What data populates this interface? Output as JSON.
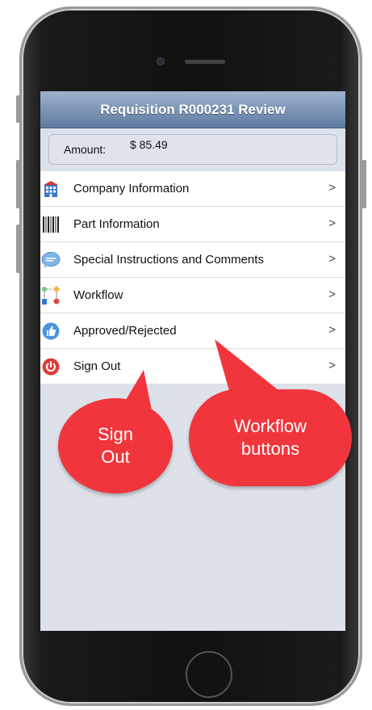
{
  "screen": {
    "title": "Requisition R000231 Review",
    "amount_label": "Amount:",
    "amount_value": "$ 85.49"
  },
  "menu": [
    {
      "label": "Company Information",
      "icon": "building-icon"
    },
    {
      "label": "Part Information",
      "icon": "barcode-icon"
    },
    {
      "label": "Special Instructions and Comments",
      "icon": "speech-bubble-icon"
    },
    {
      "label": "Workflow",
      "icon": "workflow-icon"
    },
    {
      "label": "Approved/Rejected",
      "icon": "thumbs-up-icon"
    },
    {
      "label": "Sign Out",
      "icon": "power-icon"
    }
  ],
  "chevron": ">",
  "callouts": {
    "sign_out_line1": "Sign",
    "sign_out_line2": "Out",
    "workflow_line1": "Workflow",
    "workflow_line2": "buttons"
  },
  "colors": {
    "titlebar": "#5d7ba0",
    "callout": "#f0363c",
    "screen_bg": "#dde2ea"
  }
}
